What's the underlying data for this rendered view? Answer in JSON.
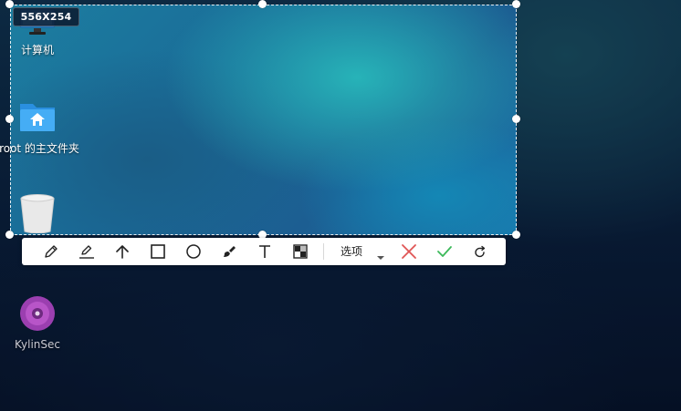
{
  "selection": {
    "size_label": "556X254"
  },
  "desktop": {
    "icons": [
      {
        "label": "计算机",
        "icon": "computer-icon"
      },
      {
        "label": "root 的主文件夹",
        "icon": "home-folder-icon"
      },
      {
        "label": "",
        "icon": "trash-icon"
      },
      {
        "label": "KylinSec",
        "icon": "kylinsec-disc-icon"
      }
    ]
  },
  "toolbar": {
    "tools": [
      {
        "name": "pencil-tool",
        "icon": "pencil-icon"
      },
      {
        "name": "marker-tool",
        "icon": "marker-underline-icon"
      },
      {
        "name": "arrow-tool",
        "icon": "arrow-up-icon"
      },
      {
        "name": "rectangle-tool",
        "icon": "rectangle-icon"
      },
      {
        "name": "circle-tool",
        "icon": "circle-icon"
      },
      {
        "name": "brush-tool",
        "icon": "brush-icon"
      },
      {
        "name": "text-tool",
        "icon": "text-icon"
      },
      {
        "name": "mosaic-tool",
        "icon": "mosaic-icon"
      }
    ],
    "options_label": "选项",
    "cancel_icon": "close-icon",
    "confirm_icon": "check-icon",
    "undo_icon": "undo-icon",
    "colors": {
      "cancel": "#e05555",
      "confirm": "#3cb95a"
    }
  }
}
